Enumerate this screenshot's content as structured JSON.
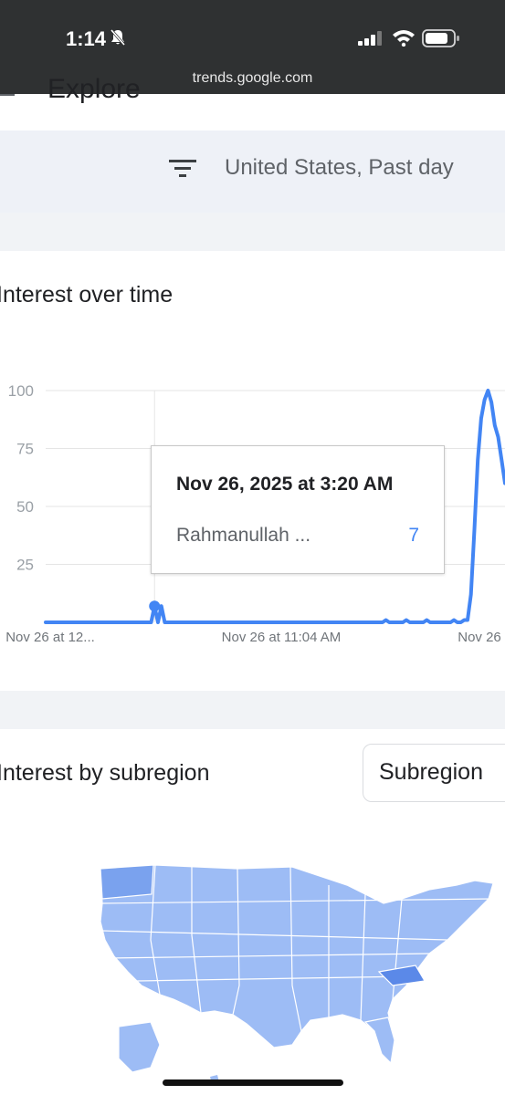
{
  "status_bar": {
    "time": "1:14",
    "url": "trends.google.com"
  },
  "header": {
    "title": "Explore"
  },
  "filter": {
    "text": "United States, Past day",
    "icon": "filter-icon"
  },
  "interest_over_time": {
    "title": "Interest over time",
    "tooltip": {
      "date": "Nov 26, 2025 at 3:20 AM",
      "term": "Rahmanullah ...",
      "value": "7"
    }
  },
  "chart_data": {
    "type": "line",
    "y_ticks": [
      "100",
      "75",
      "50",
      "25"
    ],
    "x_ticks": [
      "Nov 26 at 12...",
      "Nov 26 at 11:04 AM",
      "Nov 26"
    ],
    "ylim": [
      0,
      100
    ],
    "series": [
      {
        "color": "#4285f4",
        "values": [
          0,
          0,
          0,
          0,
          0,
          0,
          0,
          0,
          0,
          0,
          0,
          0,
          0,
          0,
          0,
          0,
          0,
          0,
          0,
          0,
          0,
          0,
          0,
          0,
          0,
          0,
          0,
          0,
          0,
          0,
          0,
          0,
          7,
          0,
          7,
          0,
          0,
          0,
          0,
          0,
          0,
          0,
          0,
          0,
          0,
          0,
          0,
          0,
          0,
          0,
          0,
          0,
          0,
          0,
          0,
          0,
          0,
          0,
          0,
          0,
          0,
          0,
          0,
          0,
          0,
          0,
          0,
          0,
          0,
          0,
          0,
          0,
          0,
          0,
          0,
          0,
          0,
          0,
          0,
          0,
          0,
          0,
          0,
          0,
          0,
          0,
          0,
          0,
          0,
          0,
          0,
          0,
          0,
          0,
          0,
          0,
          0,
          0,
          0,
          0,
          1,
          0,
          0,
          0,
          0,
          0,
          1,
          0,
          0,
          0,
          0,
          0,
          1,
          0,
          0,
          0,
          0,
          0,
          0,
          0,
          1,
          0,
          0,
          1,
          1,
          12,
          40,
          70,
          88,
          96,
          100,
          95,
          85,
          80,
          70,
          60
        ]
      }
    ],
    "highlight": {
      "index": 32,
      "value": 7
    }
  },
  "interest_by_subregion": {
    "title": "Interest by subregion",
    "dropdown_label": "Subregion",
    "map_colors": {
      "base": "#9dbcf5",
      "dark": "#7aa2ee",
      "darker": "#5b89e8",
      "border": "#ffffff"
    }
  }
}
